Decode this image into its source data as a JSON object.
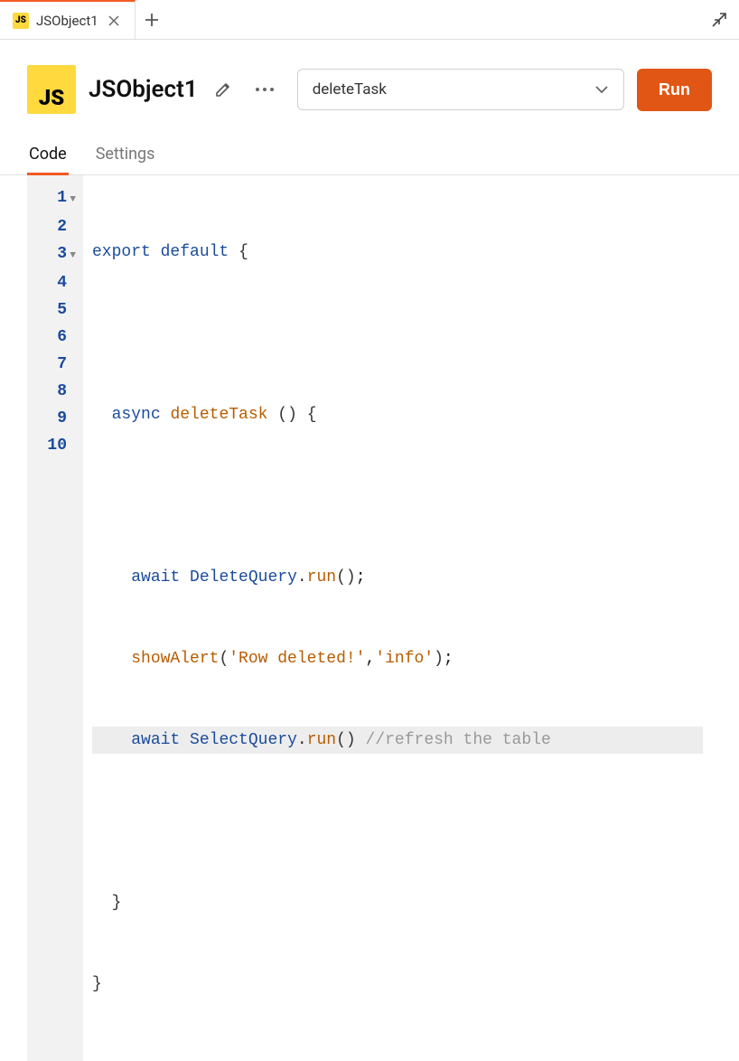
{
  "tab": {
    "icon_text": "JS",
    "title": "JSObject1"
  },
  "header": {
    "icon_text": "JS",
    "title": "JSObject1",
    "dropdown_value": "deleteTask",
    "run_label": "Run"
  },
  "editor_tabs": {
    "code": "Code",
    "settings": "Settings"
  },
  "code": {
    "line1": {
      "kw1": "export",
      "kw2": "default",
      "brace": "{"
    },
    "line3": {
      "kw": "async",
      "name": "deleteTask",
      "parens": "()",
      "brace": "{"
    },
    "line5": {
      "kw": "await",
      "obj": "DeleteQuery",
      "method": "run",
      "parens": "()",
      "semi": ";"
    },
    "line6": {
      "fn": "showAlert",
      "str1": "'Row deleted!'",
      "comma": ",",
      "str2": "'info'",
      "parens_open": "(",
      "parens_close": ")",
      "semi": ";"
    },
    "line7": {
      "kw": "await",
      "obj": "SelectQuery",
      "method": "run",
      "parens": "()",
      "comment": "//refresh the table"
    },
    "line9": {
      "brace": "}"
    },
    "line10": {
      "brace": "}"
    }
  },
  "gutter": [
    "1",
    "2",
    "3",
    "4",
    "5",
    "6",
    "7",
    "8",
    "9",
    "10"
  ]
}
